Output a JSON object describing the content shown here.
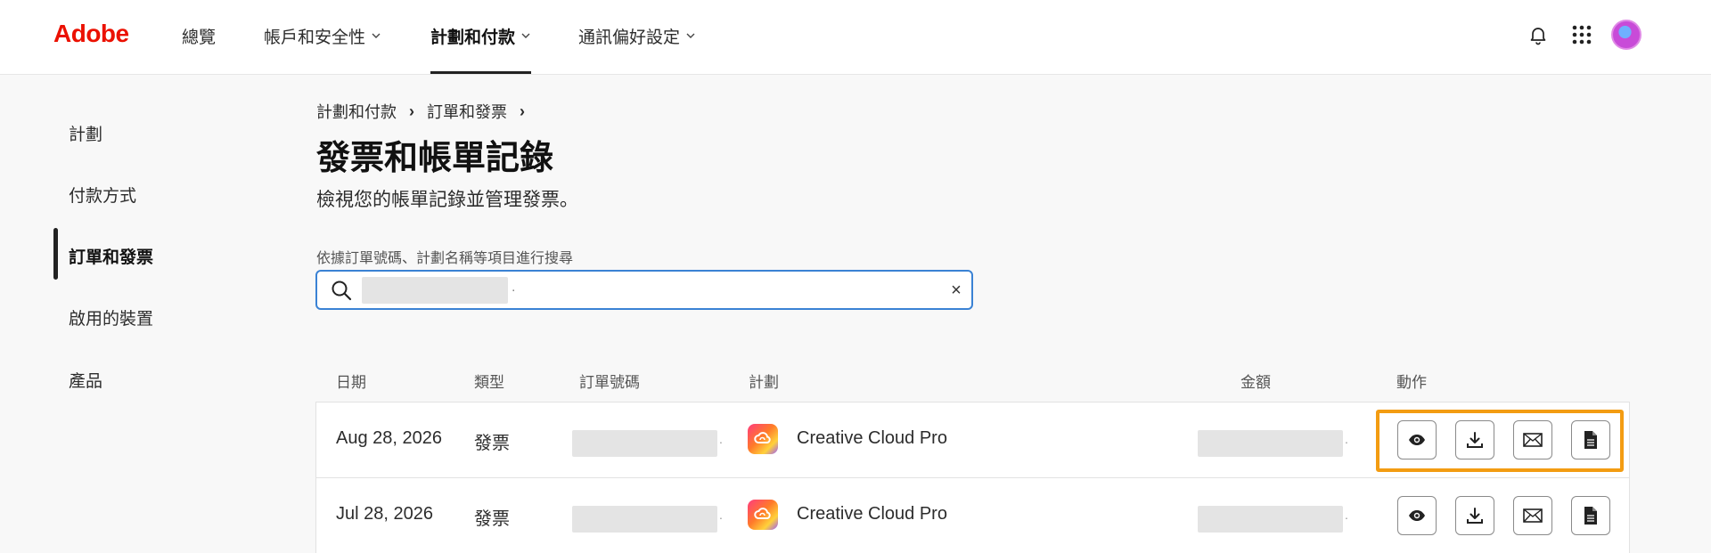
{
  "brand": {
    "logo_text": "Adobe",
    "logo_color": "#eb1000"
  },
  "topnav": {
    "items": [
      {
        "label": "總覽",
        "has_menu": false
      },
      {
        "label": "帳戶和安全性",
        "has_menu": true
      },
      {
        "label": "計劃和付款",
        "has_menu": true,
        "active": true
      },
      {
        "label": "通訊偏好設定",
        "has_menu": true
      }
    ],
    "icons": [
      "bell-icon",
      "app-grid-icon",
      "avatar"
    ]
  },
  "sidebar": {
    "items": [
      {
        "label": "計劃"
      },
      {
        "label": "付款方式"
      },
      {
        "label": "訂單和發票",
        "active": true
      },
      {
        "label": "啟用的裝置"
      },
      {
        "label": "產品"
      }
    ]
  },
  "breadcrumb": {
    "items": [
      "計劃和付款",
      "訂單和發票"
    ],
    "separator": "›"
  },
  "page": {
    "title": "發票和帳單記錄",
    "subtitle": "檢視您的帳單記錄並管理發票。"
  },
  "search": {
    "label": "依據訂單號碼、計劃名稱等項目進行搜尋",
    "trailing": ".",
    "clear_symbol": "×",
    "border_color": "#3a82d4"
  },
  "table": {
    "headers": {
      "date": "日期",
      "type": "類型",
      "order": "訂單號碼",
      "plan": "計劃",
      "amount": "金額",
      "actions": "動作"
    },
    "rows": [
      {
        "date": "Aug 28, 2026",
        "type": "發票",
        "plan": "Creative Cloud Pro",
        "redact_mark": "."
      },
      {
        "date": "Jul 28, 2026",
        "type": "發票",
        "plan": "Creative Cloud Pro",
        "redact_mark": "."
      }
    ],
    "actions": [
      "view-icon",
      "download-icon",
      "email-icon",
      "document-icon"
    ],
    "highlight_color": "#f39c12"
  }
}
